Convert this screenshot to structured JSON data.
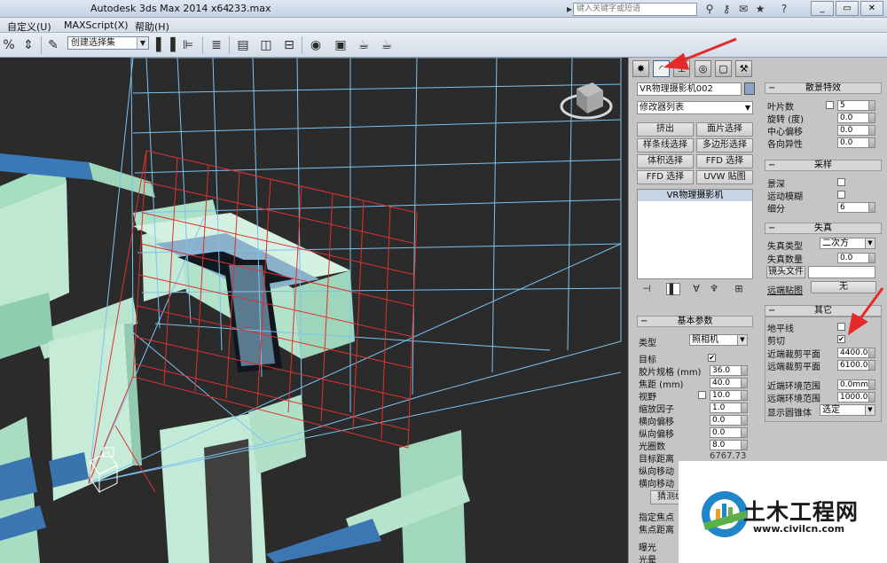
{
  "titlebar": {
    "app_title": "Autodesk 3ds Max  2014 x64",
    "file_name": "233.max",
    "search_placeholder": "键入关键字或短语"
  },
  "menu": [
    "自定义(U)",
    "MAXScript(X)",
    "帮助(H)"
  ],
  "toolbar": {
    "selection_set": "创建选择集"
  },
  "panel": {
    "object_name": "VR物理摄影机002",
    "modifier_list": "修改器列表",
    "modifier_buttons": [
      "挤出",
      "面片选择",
      "样条线选择",
      "多边形选择",
      "体积选择",
      "FFD 选择",
      "FFD 选择",
      "UVW 贴图"
    ],
    "stack_item": "VR物理摄影机",
    "bottom_left": "远端贴图",
    "bottom_right": "无",
    "basic": {
      "title": "基本参数",
      "type_label": "类型",
      "type_value": "照相机",
      "rows": [
        {
          "label": "目标",
          "kind": "check",
          "value": "✔"
        },
        {
          "label": "胶片规格 (mm)",
          "kind": "spin",
          "value": "36.0"
        },
        {
          "label": "焦距 (mm)",
          "kind": "spin",
          "value": "40.0"
        },
        {
          "label": "视野",
          "kind": "spin",
          "value": "10.0"
        },
        {
          "label": "缩放因子",
          "kind": "spin",
          "value": "1.0"
        },
        {
          "label": "横向偏移",
          "kind": "spin",
          "value": "0.0"
        },
        {
          "label": "纵向偏移",
          "kind": "spin",
          "value": "0.0"
        },
        {
          "label": "光圈数",
          "kind": "spin",
          "value": "8.0"
        },
        {
          "label": "目标距离",
          "kind": "text",
          "value": "6767.73"
        },
        {
          "label": "纵向移动",
          "kind": "none",
          "value": ""
        },
        {
          "label": "横向移动",
          "kind": "none",
          "value": ""
        }
      ],
      "guess_button": "猜测纵向",
      "more": [
        "指定焦点",
        "焦点距离",
        "曝光",
        "光晕"
      ]
    },
    "bokeh": {
      "title": "散景特效",
      "rows": [
        {
          "label": "叶片数",
          "value": "5"
        },
        {
          "label": "旋转 (度)",
          "value": "0.0"
        },
        {
          "label": "中心偏移",
          "value": "0.0"
        },
        {
          "label": "各向异性",
          "value": "0.0"
        }
      ]
    },
    "sampling": {
      "title": "采样",
      "rows": [
        {
          "label": "景深",
          "kind": "check"
        },
        {
          "label": "运动模糊",
          "kind": "check"
        },
        {
          "label": "细分",
          "kind": "spin",
          "value": "6"
        }
      ]
    },
    "distortion": {
      "title": "失真",
      "type_label": "失真类型",
      "type_value": "二次方",
      "amount_label": "失真数量",
      "amount_value": "0.0",
      "lens_file": "镜头文件"
    },
    "misc": {
      "title": "其它",
      "horizon_label": "地平线",
      "clip_label": "剪切",
      "clip_check": "✔",
      "near_clip_label": "近端裁剪平面",
      "near_clip_value": "4400.0",
      "far_clip_label": "远端裁剪平面",
      "far_clip_value": "6100.0",
      "near_env_label": "近端环境范围",
      "near_env_value": "0.0mm",
      "far_env_label": "远端环境范围",
      "far_env_value": "1000.0",
      "cone_label": "显示圆锥体",
      "cone_value": "选定"
    }
  },
  "watermark": {
    "text": "土木工程网",
    "url": "www.civilcn.com"
  },
  "colors": {
    "viewport_bg": "#2b2b2b",
    "wire_blue": "#7ec3f0",
    "wire_red": "#e03030",
    "arrow_red": "#e52a2a"
  }
}
